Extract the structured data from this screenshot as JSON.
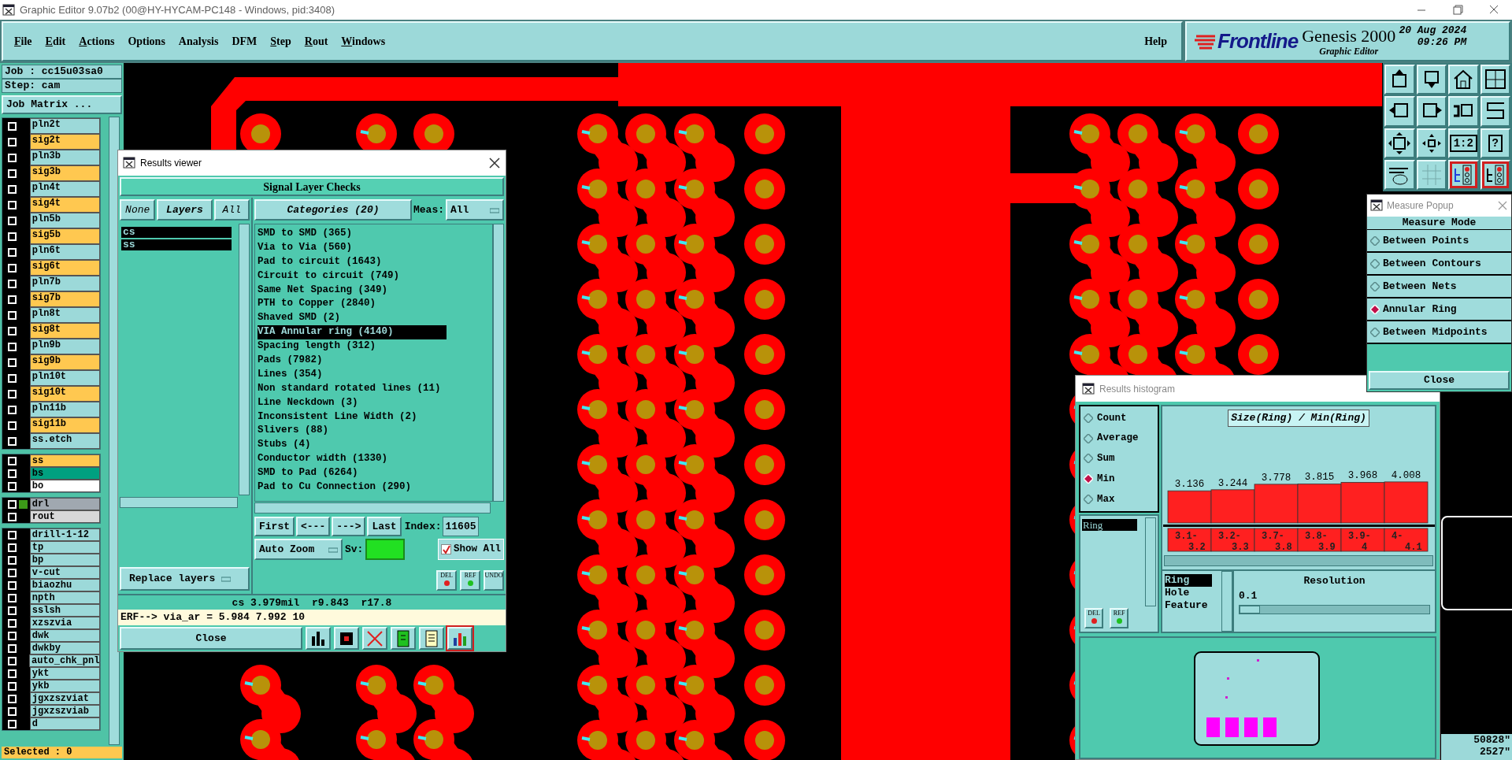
{
  "window": {
    "title": "Graphic Editor 9.07b2 (00@HY-HYCAM-PC148 - Windows, pid:3408)"
  },
  "menu": [
    {
      "label": "File",
      "mnemonic": true
    },
    {
      "label": "Edit",
      "mnemonic": true
    },
    {
      "label": "Actions",
      "mnemonic": true
    },
    {
      "label": "Options",
      "mnemonic": false
    },
    {
      "label": "Analysis",
      "mnemonic": false
    },
    {
      "label": "DFM",
      "mnemonic": false
    },
    {
      "label": "Step",
      "mnemonic": true
    },
    {
      "label": "Rout",
      "mnemonic": true
    },
    {
      "label": "Windows",
      "mnemonic": true
    }
  ],
  "help": "Help",
  "brand": {
    "logo": "Frontline",
    "product": "Genesis 2000",
    "subtitle": "Graphic Editor",
    "date": "20 Aug 2024",
    "time": "09:26 PM"
  },
  "job": {
    "job": "Job : cc15u03sa0",
    "step": "Step: cam",
    "matrix_button": "Job Matrix ...",
    "selected": "Selected : 0"
  },
  "layer_groups": [
    {
      "layers": [
        {
          "name": "pln2t",
          "color": "#9cd9d9",
          "checked": false,
          "marked": false
        },
        {
          "name": "sig2t",
          "color": "#ffc850",
          "checked": false,
          "marked": false
        },
        {
          "name": "pln3b",
          "color": "#9cd9d9",
          "checked": false,
          "marked": false
        },
        {
          "name": "sig3b",
          "color": "#ffc850",
          "checked": false,
          "marked": false
        },
        {
          "name": "pln4t",
          "color": "#9cd9d9",
          "checked": false,
          "marked": false
        },
        {
          "name": "sig4t",
          "color": "#ffc850",
          "checked": false,
          "marked": false
        },
        {
          "name": "pln5b",
          "color": "#9cd9d9",
          "checked": false,
          "marked": false
        },
        {
          "name": "sig5b",
          "color": "#ffc850",
          "checked": false,
          "marked": false
        },
        {
          "name": "pln6t",
          "color": "#9cd9d9",
          "checked": false,
          "marked": false
        },
        {
          "name": "sig6t",
          "color": "#ffc850",
          "checked": false,
          "marked": false
        },
        {
          "name": "pln7b",
          "color": "#9cd9d9",
          "checked": false,
          "marked": false
        },
        {
          "name": "sig7b",
          "color": "#ffc850",
          "checked": false,
          "marked": false
        },
        {
          "name": "pln8t",
          "color": "#9cd9d9",
          "checked": false,
          "marked": false
        },
        {
          "name": "sig8t",
          "color": "#ffc850",
          "checked": false,
          "marked": false
        },
        {
          "name": "pln9b",
          "color": "#9cd9d9",
          "checked": false,
          "marked": false
        },
        {
          "name": "sig9b",
          "color": "#ffc850",
          "checked": false,
          "marked": false
        },
        {
          "name": "pln10t",
          "color": "#9cd9d9",
          "checked": false,
          "marked": false
        },
        {
          "name": "sig10t",
          "color": "#ffc850",
          "checked": false,
          "marked": false
        },
        {
          "name": "pln11b",
          "color": "#9cd9d9",
          "checked": false,
          "marked": false
        },
        {
          "name": "sig11b",
          "color": "#ffc850",
          "checked": false,
          "marked": false
        },
        {
          "name": "ss.etch",
          "color": "#9cd9d9",
          "checked": false,
          "marked": false
        }
      ]
    },
    {
      "layers": [
        {
          "name": "ss",
          "color": "#ffc850",
          "checked": false,
          "marked": false
        },
        {
          "name": "bs",
          "color": "#00a080",
          "checked": false,
          "marked": false
        },
        {
          "name": "bo",
          "color": "#ffffff",
          "checked": false,
          "marked": false
        }
      ]
    },
    {
      "layers": [
        {
          "name": "drl",
          "color": "#a0a8b0",
          "checked": false,
          "marked": true
        },
        {
          "name": "rout",
          "color": "#d8d8d8",
          "checked": false,
          "marked": false
        }
      ]
    },
    {
      "layers": [
        {
          "name": "drill-1-12",
          "color": "#9cd9d9",
          "checked": false,
          "marked": false
        },
        {
          "name": "tp",
          "color": "#9cd9d9",
          "checked": false,
          "marked": false
        },
        {
          "name": "bp",
          "color": "#9cd9d9",
          "checked": false,
          "marked": false
        },
        {
          "name": "v-cut",
          "color": "#9cd9d9",
          "checked": false,
          "marked": false
        },
        {
          "name": "biaozhu",
          "color": "#9cd9d9",
          "checked": false,
          "marked": false
        },
        {
          "name": "npth",
          "color": "#9cd9d9",
          "checked": false,
          "marked": false
        },
        {
          "name": "sslsh",
          "color": "#9cd9d9",
          "checked": false,
          "marked": false
        },
        {
          "name": "xzszvia",
          "color": "#9cd9d9",
          "checked": false,
          "marked": false
        },
        {
          "name": "dwk",
          "color": "#9cd9d9",
          "checked": false,
          "marked": false
        },
        {
          "name": "dwkby",
          "color": "#9cd9d9",
          "checked": false,
          "marked": false
        },
        {
          "name": "auto_chk_pnl",
          "color": "#9cd9d9",
          "checked": false,
          "marked": false
        },
        {
          "name": "ykt",
          "color": "#9cd9d9",
          "checked": false,
          "marked": false
        },
        {
          "name": "ykb",
          "color": "#9cd9d9",
          "checked": false,
          "marked": false
        },
        {
          "name": "jgxzszviat",
          "color": "#9cd9d9",
          "checked": false,
          "marked": false
        },
        {
          "name": "jgxzszviab",
          "color": "#9cd9d9",
          "checked": false,
          "marked": false
        },
        {
          "name": "d",
          "color": "#9cd9d9",
          "checked": false,
          "marked": false
        }
      ]
    }
  ],
  "toolbar": [
    {
      "selected": false
    },
    {
      "selected": false
    },
    {
      "selected": false
    },
    {
      "selected": false
    },
    {
      "selected": false
    },
    {
      "selected": false
    },
    {
      "selected": false
    },
    {
      "selected": false
    },
    {
      "selected": false
    },
    {
      "selected": false
    },
    {
      "label": "1:2",
      "selected": false
    },
    {
      "label": "?",
      "selected": false
    },
    {
      "selected": false
    },
    {
      "selected": false
    },
    {
      "selected": true
    },
    {
      "selected": true
    }
  ],
  "results_viewer": {
    "title": "Results viewer",
    "header": "Signal Layer Checks",
    "layer_buttons": [
      "None",
      "Layers",
      "All"
    ],
    "layers": [
      {
        "name": "cs",
        "selected": true
      },
      {
        "name": "ss",
        "selected": true
      }
    ],
    "categories_button": "Categories (20)",
    "meas_label": "Meas:",
    "meas_value": "All",
    "categories": [
      {
        "label": "SMD to SMD (365)",
        "selected": false
      },
      {
        "label": "Via to Via (560)",
        "selected": false
      },
      {
        "label": "Pad to circuit (1643)",
        "selected": false
      },
      {
        "label": "Circuit to circuit (749)",
        "selected": false
      },
      {
        "label": "Same Net Spacing (349)",
        "selected": false
      },
      {
        "label": "PTH to Copper (2840)",
        "selected": false
      },
      {
        "label": "Shaved SMD (2)",
        "selected": false
      },
      {
        "label": "VIA Annular ring (4140)",
        "selected": true
      },
      {
        "label": "Spacing length (312)",
        "selected": false
      },
      {
        "label": "Pads (7982)",
        "selected": false
      },
      {
        "label": "Lines (354)",
        "selected": false
      },
      {
        "label": "Non standard rotated lines (11)",
        "selected": false
      },
      {
        "label": "Line Neckdown (3)",
        "selected": false
      },
      {
        "label": "Inconsistent Line Width (2)",
        "selected": false
      },
      {
        "label": "Slivers (88)",
        "selected": false
      },
      {
        "label": "Stubs (4)",
        "selected": false
      },
      {
        "label": "Conductor width (1330)",
        "selected": false
      },
      {
        "label": "SMD to Pad (6264)",
        "selected": false
      },
      {
        "label": "Pad to Cu Connection (290)",
        "selected": false
      }
    ],
    "nav_buttons": [
      "First",
      "<---",
      "--->",
      "Last"
    ],
    "index_label": "Index:",
    "index_value": "11605",
    "zoom_mode": "Auto Zoom",
    "sv_label": "Sv:",
    "show_all": {
      "label": "Show All",
      "checked": true
    },
    "replace_mode": "Replace layers",
    "action_buttons": [
      "DEL",
      "REF",
      "UNDO"
    ],
    "measure": "cs 3.979mil  r9.843  r17.8",
    "erf": "ERF--> via_ar = 5.984 7.992 10",
    "close": "Close",
    "tool_buttons": [
      {
        "selected": false
      },
      {
        "selected": false
      },
      {
        "selected": false
      },
      {
        "selected": false
      },
      {
        "selected": false
      },
      {
        "selected": true
      }
    ]
  },
  "measure_popup": {
    "title": "Measure Popup",
    "header": "Measure Mode",
    "modes": [
      {
        "label": "Between Points",
        "selected": false
      },
      {
        "label": "Between Contours",
        "selected": false
      },
      {
        "label": "Between Nets",
        "selected": false
      },
      {
        "label": "Annular Ring",
        "selected": true
      },
      {
        "label": "Between Midpoints",
        "selected": false
      }
    ],
    "close": "Close"
  },
  "histogram": {
    "title": "Results histogram",
    "functions": [
      {
        "label": "Count",
        "selected": false
      },
      {
        "label": "Average",
        "selected": false
      },
      {
        "label": "Sum",
        "selected": false
      },
      {
        "label": "Min",
        "selected": true
      },
      {
        "label": "Max",
        "selected": false
      }
    ],
    "fields": [
      {
        "label": "Ring",
        "selected": true
      }
    ],
    "action_buttons": [
      "DEL",
      "REF"
    ],
    "chart_data": {
      "type": "bar",
      "title": "Size(Ring) / Min(Ring)",
      "categories": [
        "3.1-3.2",
        "3.2-3.3",
        "3.7-3.8",
        "3.8-3.9",
        "3.9-4",
        "4-4.1"
      ],
      "values": [
        3.136,
        3.244,
        3.778,
        3.815,
        3.968,
        4.008
      ],
      "data_labels": true
    },
    "attributes": [
      {
        "label": "Ring",
        "selected": true
      },
      {
        "label": "Hole",
        "selected": false
      },
      {
        "label": "Feature",
        "selected": false
      }
    ],
    "resolution": {
      "label": "Resolution",
      "value": "0.1",
      "level": 0
    }
  },
  "coords": [
    "50828\"",
    "2527\""
  ]
}
